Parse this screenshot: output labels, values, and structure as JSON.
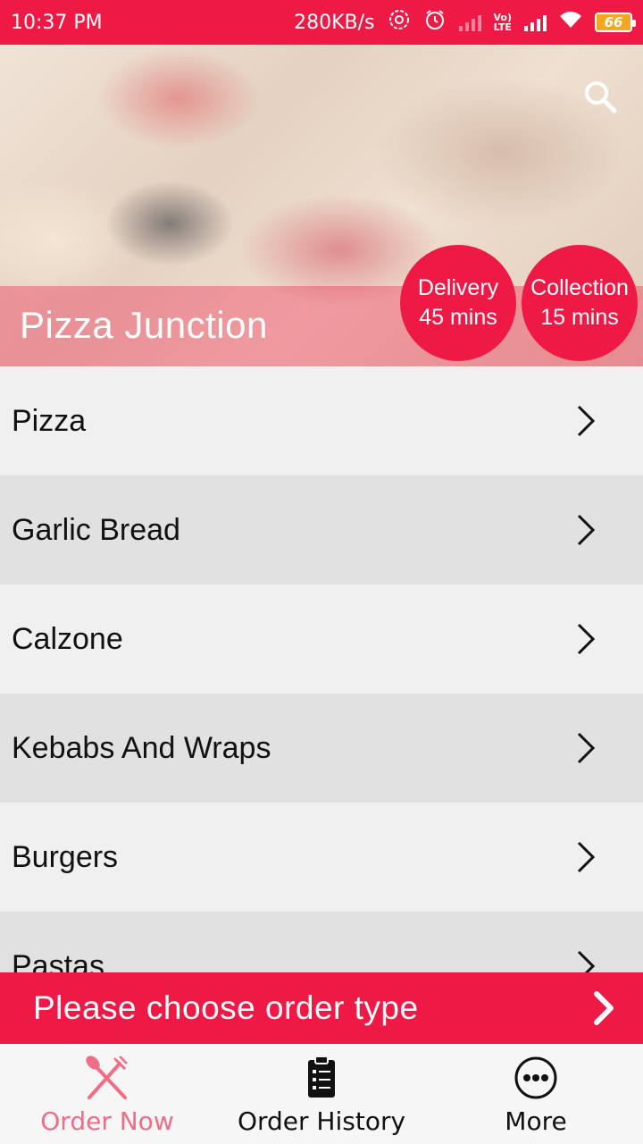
{
  "status_bar": {
    "time": "10:37 PM",
    "speed": "280KB/s",
    "volte": "Vo)) LTE",
    "battery": "66"
  },
  "restaurant": {
    "name": "Pizza Junction",
    "delivery_label": "Delivery",
    "delivery_time": "45 mins",
    "collection_label": "Collection",
    "collection_time": "15 mins"
  },
  "categories": [
    {
      "label": "Pizza"
    },
    {
      "label": "Garlic Bread"
    },
    {
      "label": "Calzone"
    },
    {
      "label": "Kebabs And Wraps"
    },
    {
      "label": "Burgers"
    },
    {
      "label": "Pastas"
    }
  ],
  "order_bar": {
    "label": "Please choose order type"
  },
  "bottom_nav": {
    "items": [
      {
        "label": "Order Now",
        "icon": "fork-knife-icon",
        "active": true
      },
      {
        "label": "Order History",
        "icon": "clipboard-icon",
        "active": false
      },
      {
        "label": "More",
        "icon": "more-dots-icon",
        "active": false
      }
    ]
  },
  "colors": {
    "accent": "#ee1a45",
    "active_nav": "#ef6d85"
  }
}
